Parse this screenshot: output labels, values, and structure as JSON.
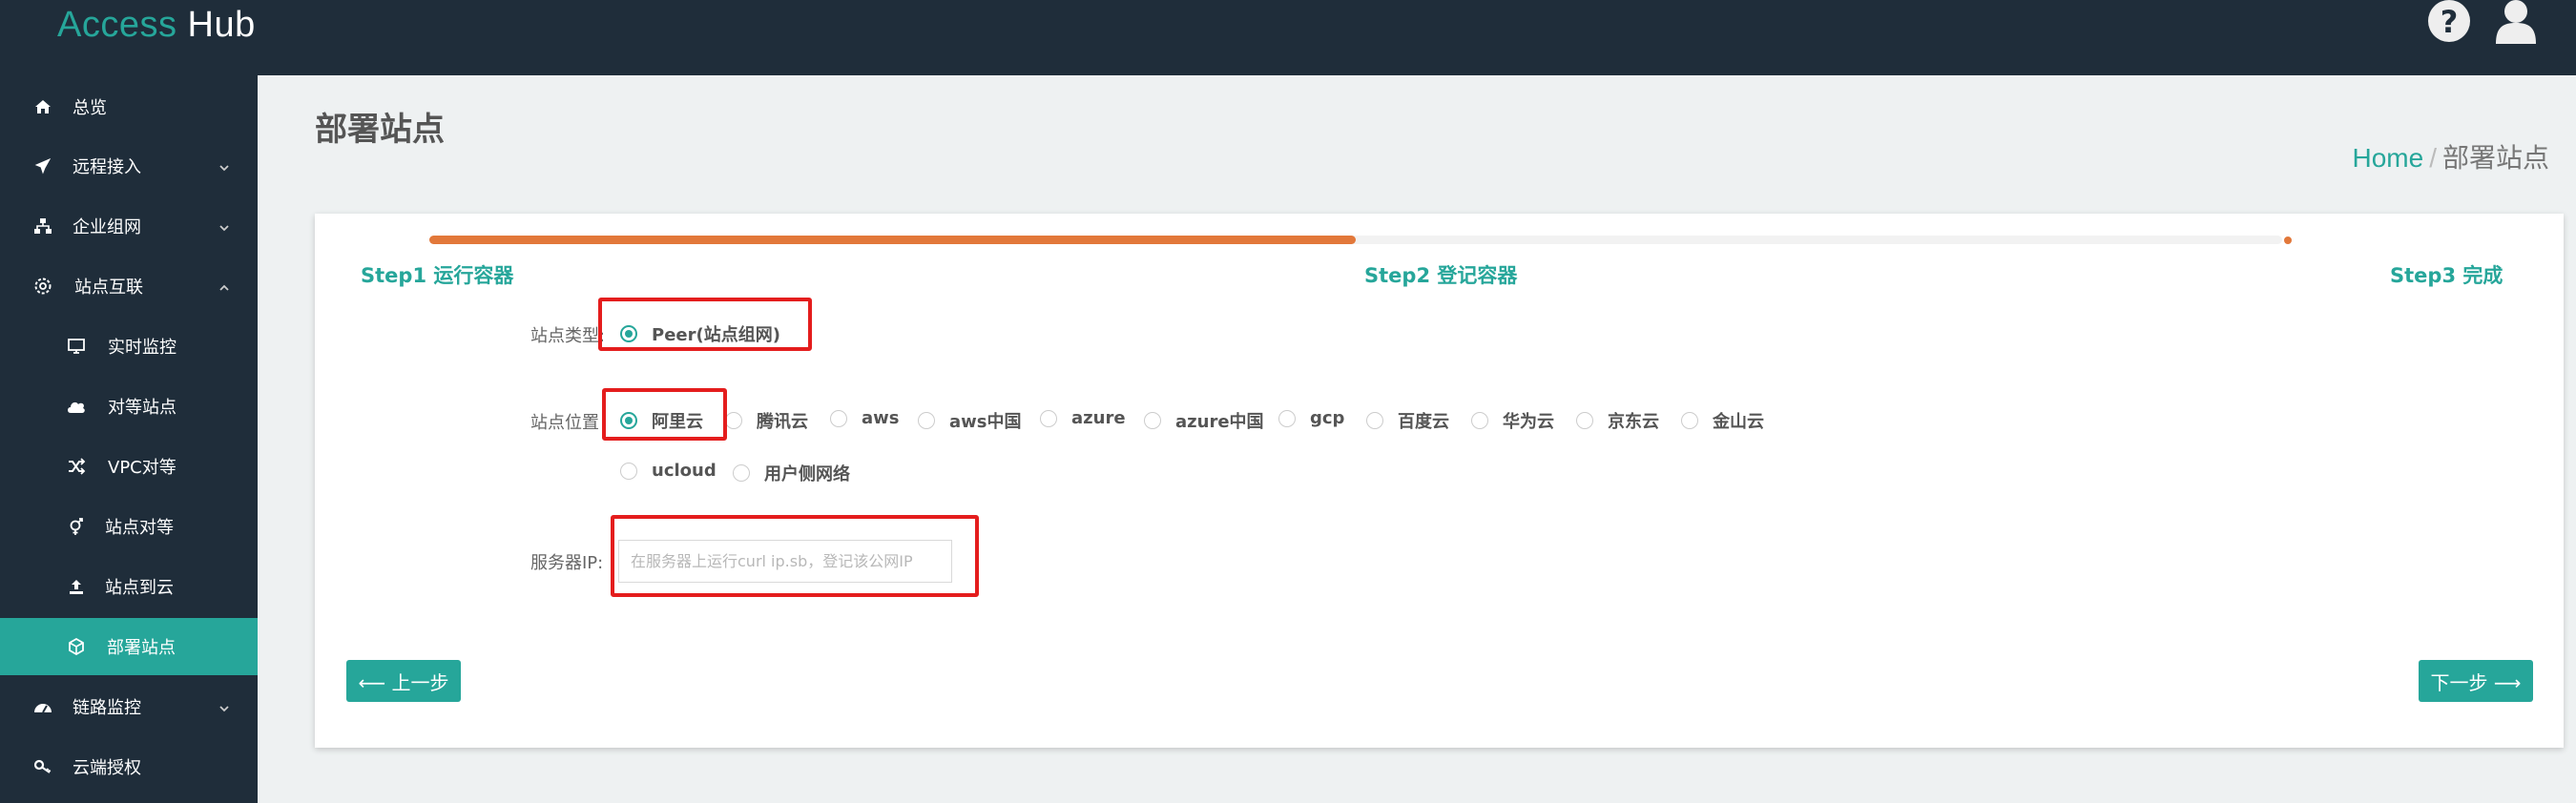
{
  "app": {
    "logo_part1": "Access",
    "logo_part2": "Hub"
  },
  "header": {
    "icons": [
      "help-icon",
      "user-icon"
    ]
  },
  "sidebar": {
    "items": [
      {
        "label": "总览",
        "icon": "home-icon"
      },
      {
        "label": "远程接入",
        "icon": "plane-icon",
        "expandable": true
      },
      {
        "label": "企业组网",
        "icon": "sitemap-icon",
        "expandable": true
      },
      {
        "label": "站点互联",
        "icon": "gear-icon",
        "expandable": true,
        "expanded": true
      },
      {
        "label": "实时监控",
        "icon": "monitor-icon"
      },
      {
        "label": "对等站点",
        "icon": "cloud-icon"
      },
      {
        "label": "VPC对等",
        "icon": "shuffle-icon"
      },
      {
        "label": "站点对等",
        "icon": "venus-mars-icon"
      },
      {
        "label": "站点到云",
        "icon": "upload-icon"
      },
      {
        "label": "部署站点",
        "icon": "cube-icon",
        "active": true
      },
      {
        "label": "链路监控",
        "icon": "dashboard-icon",
        "expandable": true
      },
      {
        "label": "云端授权",
        "icon": "key-icon"
      }
    ]
  },
  "main": {
    "title": "部署站点",
    "breadcrumb": {
      "home": "Home",
      "separator": "/",
      "current": "部署站点"
    }
  },
  "wizard": {
    "progress": 0.5,
    "steps": [
      "Step1 运行容器",
      "Step2 登记容器",
      "Step3 完成"
    ],
    "site_type": {
      "label": "站点类型:",
      "options": [
        "Peer(站点组网)"
      ],
      "selected": "Peer(站点组网)"
    },
    "site_location": {
      "label": "站点位置",
      "options": [
        "阿里云",
        "腾讯云",
        "aws",
        "aws中国",
        "azure",
        "azure中国",
        "gcp",
        "百度云",
        "华为云",
        "京东云",
        "金山云",
        "ucloud",
        "用户侧网络"
      ],
      "selected": "阿里云"
    },
    "server_ip": {
      "label": "服务器IP:",
      "value": "",
      "placeholder": "在服务器上运行curl ip.sb，登记该公网IP"
    },
    "prev_label": "⟵ 上一步",
    "next_label": "下一步 ⟶"
  },
  "colors": {
    "accent": "#26a69a",
    "progress": "#e2783a",
    "nav_bg": "#1f2d3a",
    "highlight": "#e41d1d"
  }
}
